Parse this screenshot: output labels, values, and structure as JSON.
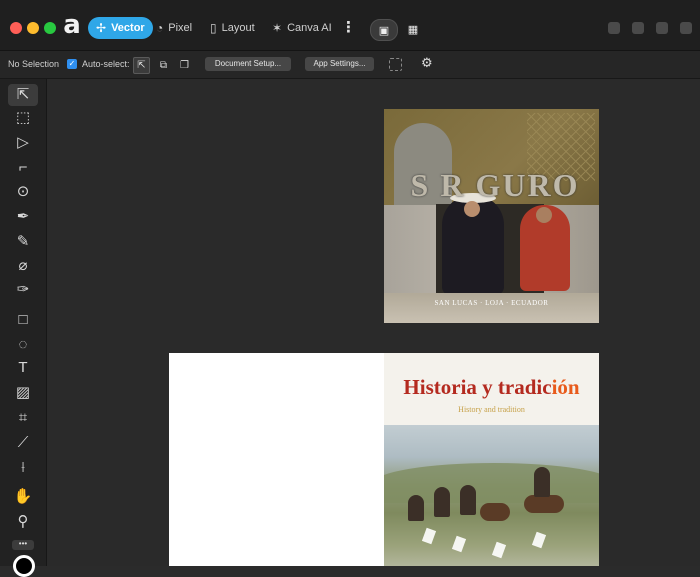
{
  "titlebar": {
    "personas": [
      {
        "label": "Vector",
        "icon": "vector-persona-icon",
        "active": true
      },
      {
        "label": "Pixel",
        "icon": "pixel-persona-icon",
        "active": false
      },
      {
        "label": "Layout",
        "icon": "layout-persona-icon",
        "active": false
      },
      {
        "label": "Canva AI",
        "icon": "sparkle-icon",
        "active": false
      }
    ],
    "more_label": "⋮"
  },
  "context_toolbar": {
    "selection_status": "No Selection",
    "auto_select_label": "Auto-select:",
    "auto_select_checked": true,
    "document_setup_label": "Document Setup...",
    "app_settings_label": "App Settings..."
  },
  "tools": [
    "move-tool-icon",
    "artboard-tool-icon",
    "node-tool-icon",
    "corner-tool-icon",
    "point-transform-tool-icon",
    "pen-tool-icon",
    "pencil-tool-icon",
    "vector-brush-tool-icon",
    "vector-flood-fill-icon",
    "rectangle-tool-icon",
    "shape-builder-icon",
    "text-tool-icon",
    "picture-frame-icon",
    "crop-tool-icon",
    "gradient-tool-icon",
    "color-picker-icon",
    "view-tool-icon",
    "zoom-tool-icon"
  ],
  "tools_more_label": "•••",
  "canvas": {
    "cover_top": {
      "title": "S   R  GURO",
      "caption": "SAN LUCAS · LOJA · ECUADOR"
    },
    "spread": {
      "title_main": "Historia y tradic",
      "title_highlight": "ión",
      "subtitle": "History and tradition"
    }
  },
  "colors": {
    "accent": "#2fa7e8",
    "title_red": "#b42a1f",
    "title_orange": "#e85b1b"
  }
}
